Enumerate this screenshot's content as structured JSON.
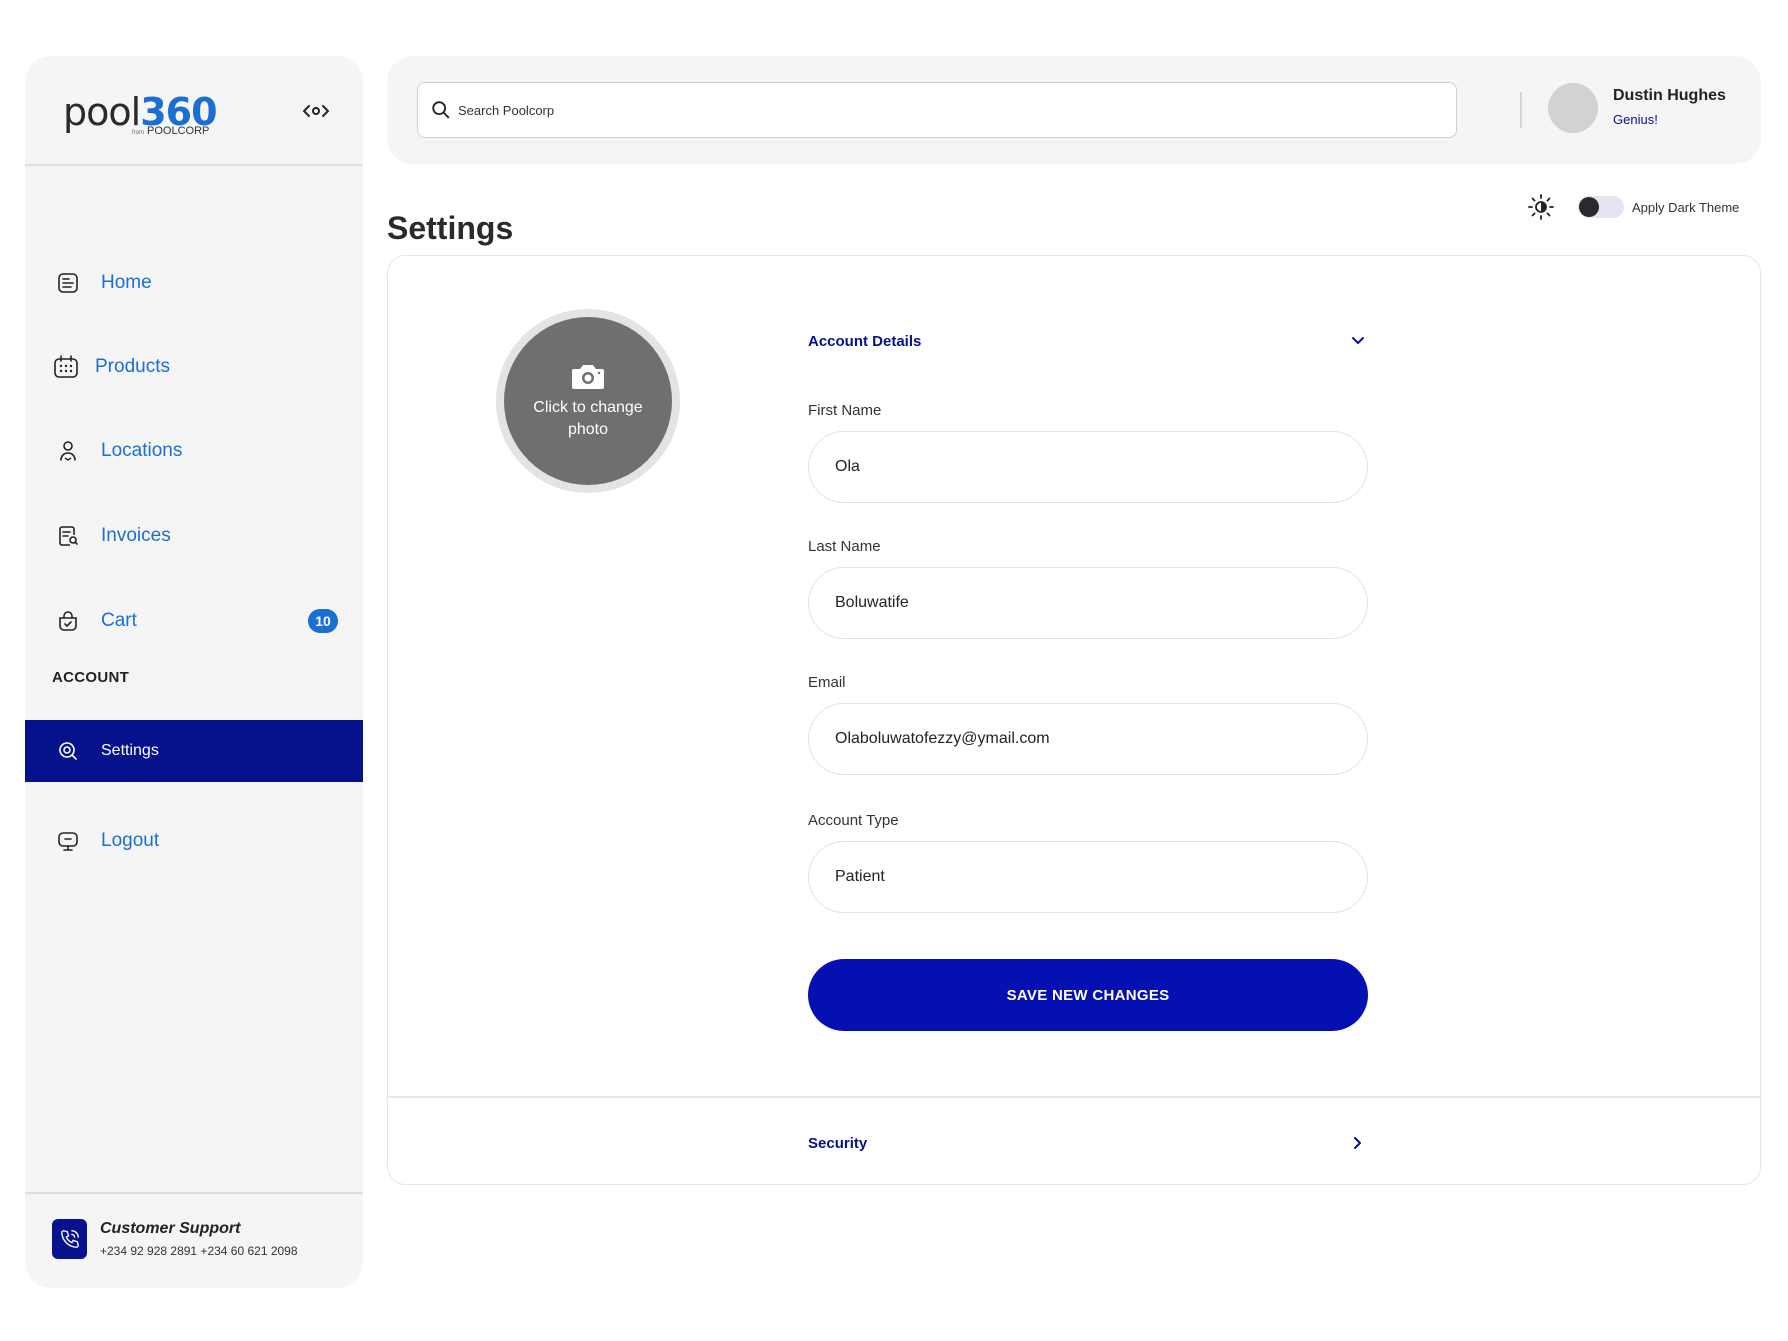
{
  "brand": {
    "logo_text": "pool",
    "logo_num": "360",
    "logo_from": "from",
    "logo_sub": "POOLCORP"
  },
  "sidebar": {
    "items": [
      {
        "label": "Home",
        "icon": "home-doc-icon"
      },
      {
        "label": "Products",
        "icon": "calendar-grid-icon"
      },
      {
        "label": "Locations",
        "icon": "person-location-icon"
      },
      {
        "label": "Invoices",
        "icon": "invoice-search-icon"
      },
      {
        "label": "Cart",
        "icon": "cart-icon",
        "badge": "10"
      }
    ],
    "section_label": "ACCOUNT",
    "account_items": [
      {
        "label": "Settings",
        "icon": "settings-icon",
        "active": true
      },
      {
        "label": "Logout",
        "icon": "logout-icon"
      }
    ],
    "support": {
      "title": "Customer Support",
      "phones": "+234 92 928 2891  +234 60 621 2098"
    }
  },
  "topbar": {
    "search_placeholder": "Search Poolcorp",
    "user_name": "Dustin Hughes",
    "user_role": "Genius!"
  },
  "theme": {
    "label": "Apply Dark Theme"
  },
  "page": {
    "title": "Settings"
  },
  "profile": {
    "photo_text": "Click to change photo"
  },
  "account_details": {
    "title": "Account Details",
    "fields": [
      {
        "label": "First Name",
        "value": "Ola"
      },
      {
        "label": "Last Name",
        "value": "Boluwatife"
      },
      {
        "label": "Email",
        "value": "Olaboluwatofezzy@ymail.com"
      },
      {
        "label": "Account Type",
        "value": "Patient"
      }
    ],
    "save_label": "SAVE NEW CHANGES"
  },
  "security": {
    "title": "Security"
  },
  "colors": {
    "primary": "#05128c",
    "accent_blue": "#1a6fd1",
    "button": "#0510b2"
  }
}
